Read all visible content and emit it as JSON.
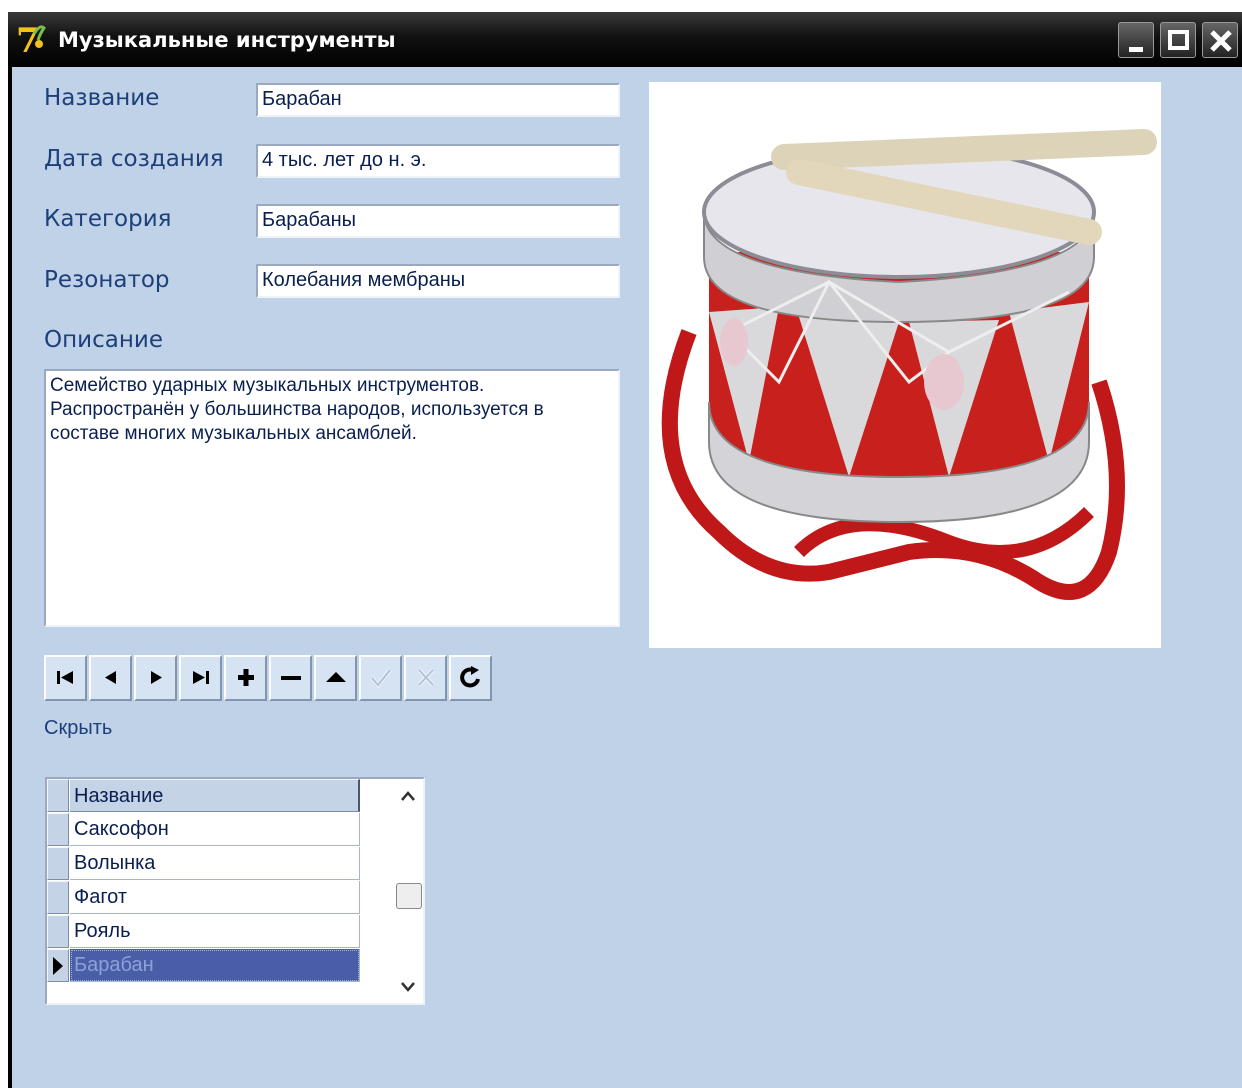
{
  "window": {
    "title": "Музыкальные инструменты",
    "icon": "app-logo-icon",
    "controls": [
      "minimize-icon",
      "maximize-icon",
      "close-icon"
    ]
  },
  "form": {
    "name_label": "Название",
    "name_value": "Барабан",
    "date_label": "Дата создания",
    "date_value": "4 тыс. лет до н. э.",
    "category_label": "Категория",
    "category_value": "Барабаны",
    "resonator_label": "Резонатор",
    "resonator_value": "Колебания мембраны",
    "description_label": "Описание",
    "description_lines": [
      "Семейство ударных музыкальных инструментов.",
      "Распространён у большинства народов, используется в",
      "составе многих музыкальных ансамблей."
    ]
  },
  "navigator": {
    "buttons": [
      "first-icon",
      "prior-icon",
      "next-icon",
      "last-icon",
      "insert-icon",
      "delete-icon",
      "edit-icon",
      "post-icon",
      "cancel-icon",
      "refresh-icon"
    ]
  },
  "hide_link": "Скрыть",
  "grid": {
    "column": "Название",
    "rows": [
      "Саксофон",
      "Волынка",
      "Фагот",
      "Рояль",
      "Барабан"
    ],
    "selected_index": 4
  },
  "colors": {
    "form_bg": "#c0d2e8",
    "label_text": "#1d3f7a",
    "selected_row": "#4a5ea8",
    "drum_red": "#c8201c"
  }
}
